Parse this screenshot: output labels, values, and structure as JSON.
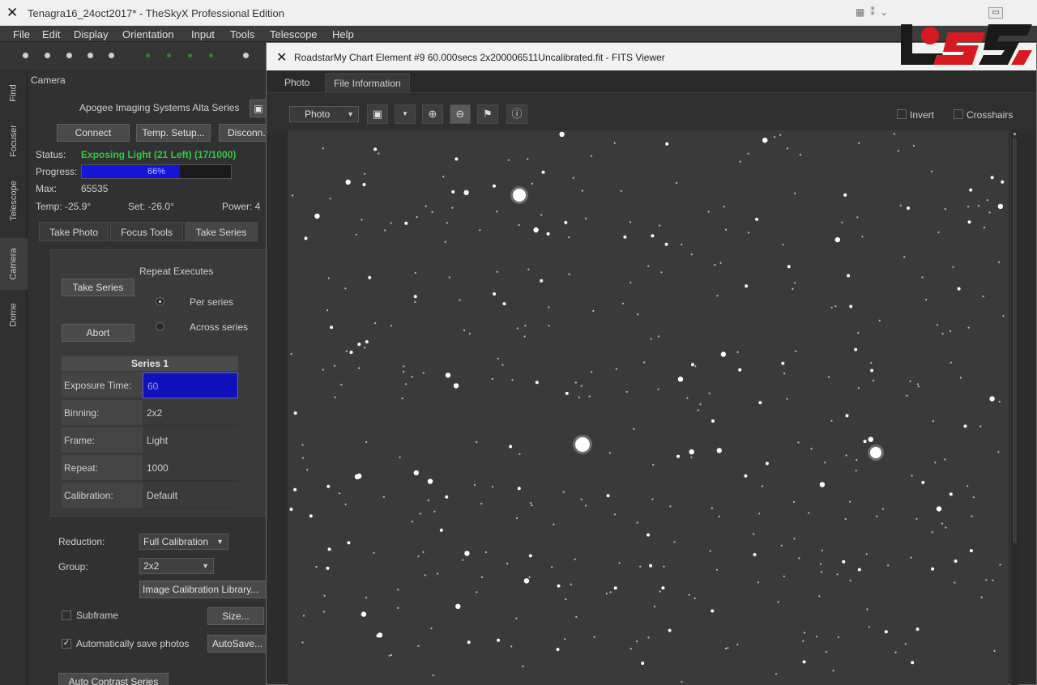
{
  "main_window": {
    "title": "Tenagra16_24oct2017* - TheSkyX Professional Edition",
    "menus": [
      "File",
      "Edit",
      "Display",
      "Orientation",
      "Input",
      "Tools",
      "Telescope",
      "Help"
    ]
  },
  "side_tabs": [
    "Find",
    "Focuser",
    "Telescope",
    "Camera",
    "Dome"
  ],
  "camera": {
    "section_title": "Camera",
    "model": "Apogee Imaging Systems Alta Series",
    "buttons": {
      "connect": "Connect",
      "temp_setup": "Temp. Setup...",
      "disconnect": "Disconn..."
    },
    "status_label": "Status:",
    "status_value": "Exposing Light (21 Left) (17/1000)",
    "progress_label": "Progress:",
    "progress_text": "66%",
    "progress_fraction": 0.66,
    "max_label": "Max:",
    "max_value": "65535",
    "temp_text": "Temp: -25.9°",
    "set_text": "Set: -26.0°",
    "power_text": "Power: 4",
    "tabs": [
      "Take Photo",
      "Focus Tools",
      "Take Series"
    ],
    "take_series_button": "Take Series",
    "abort_button": "Abort",
    "repeat_executes_label": "Repeat Executes",
    "radio_per_series": "Per series",
    "radio_across_series": "Across series",
    "series_header": "Series 1",
    "series_rows": [
      {
        "key": "Exposure Time:",
        "value": "60"
      },
      {
        "key": "Binning:",
        "value": "2x2"
      },
      {
        "key": "Frame:",
        "value": "Light"
      },
      {
        "key": "Repeat:",
        "value": "1000"
      },
      {
        "key": "Calibration:",
        "value": "Default"
      }
    ],
    "reduction_label": "Reduction:",
    "reduction_value": "Full Calibration",
    "group_label": "Group:",
    "group_value": "2x2",
    "calib_library_button": "Image Calibration Library...",
    "subframe_label": "Subframe",
    "size_button": "Size...",
    "autosave_label": "Automatically save photos",
    "autosave_button": "AutoSave...",
    "auto_contrast_button": "Auto Contrast Series"
  },
  "fits_viewer": {
    "title": "RoadstarMy Chart Element #9 60.000secs 2x200006511Uncalibrated.fit - FITS Viewer",
    "tabs": [
      "Photo",
      "File Information"
    ],
    "view_dropdown": "Photo",
    "invert_label": "Invert",
    "crosshairs_label": "Crosshairs"
  },
  "colors": {
    "status_green": "#2ecc40",
    "progress_blue": "#1515d8",
    "selection_blue": "#1111bb",
    "logo_red": "#d71920",
    "logo_dark": "#1a1a1a"
  }
}
